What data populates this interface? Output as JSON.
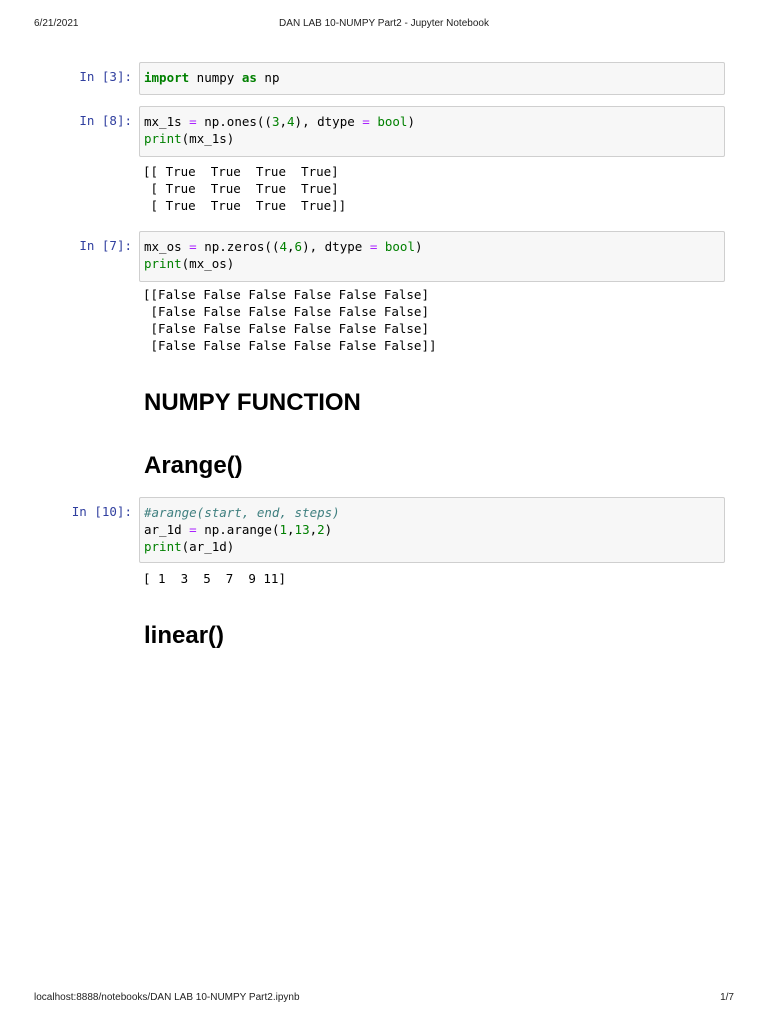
{
  "header": {
    "date": "6/21/2021",
    "title": "DAN LAB 10-NUMPY Part2 - Jupyter Notebook"
  },
  "footer": {
    "url": "localhost:8888/notebooks/DAN LAB 10-NUMPY Part2.ipynb",
    "page": "1/7"
  },
  "cells": [
    {
      "prompt": "In [3]:",
      "lines": [
        [
          {
            "t": "import",
            "c": "kw"
          },
          {
            "t": " numpy "
          },
          {
            "t": "as",
            "c": "kw"
          },
          {
            "t": " np"
          }
        ]
      ],
      "output": []
    },
    {
      "prompt": "In [8]:",
      "lines": [
        [
          {
            "t": "mx_1s "
          },
          {
            "t": "=",
            "c": "op"
          },
          {
            "t": " np.ones(("
          },
          {
            "t": "3",
            "c": "num"
          },
          {
            "t": ","
          },
          {
            "t": "4",
            "c": "num"
          },
          {
            "t": "), dtype "
          },
          {
            "t": "=",
            "c": "op"
          },
          {
            "t": " "
          },
          {
            "t": "bool",
            "c": "bi"
          },
          {
            "t": ")"
          }
        ],
        [
          {
            "t": "print",
            "c": "bi"
          },
          {
            "t": "(mx_1s)"
          }
        ]
      ],
      "output": [
        "[[ True  True  True  True]",
        " [ True  True  True  True]",
        " [ True  True  True  True]]"
      ]
    },
    {
      "prompt": "In [7]:",
      "lines": [
        [
          {
            "t": "mx_os "
          },
          {
            "t": "=",
            "c": "op"
          },
          {
            "t": " np.zeros(("
          },
          {
            "t": "4",
            "c": "num"
          },
          {
            "t": ","
          },
          {
            "t": "6",
            "c": "num"
          },
          {
            "t": "), dtype "
          },
          {
            "t": "=",
            "c": "op"
          },
          {
            "t": " "
          },
          {
            "t": "bool",
            "c": "bi"
          },
          {
            "t": ")"
          }
        ],
        [
          {
            "t": "print",
            "c": "bi"
          },
          {
            "t": "(mx_os)"
          }
        ]
      ],
      "output": [
        "[[False False False False False False]",
        " [False False False False False False]",
        " [False False False False False False]",
        " [False False False False False False]]"
      ]
    },
    {
      "prompt": "In [10]:",
      "lines": [
        [
          {
            "t": "#arange(start, end, steps)",
            "c": "cm"
          }
        ],
        [
          {
            "t": "ar_1d "
          },
          {
            "t": "=",
            "c": "op"
          },
          {
            "t": " np.arange("
          },
          {
            "t": "1",
            "c": "num"
          },
          {
            "t": ","
          },
          {
            "t": "13",
            "c": "num"
          },
          {
            "t": ","
          },
          {
            "t": "2",
            "c": "num"
          },
          {
            "t": ")"
          }
        ],
        [
          {
            "t": "print",
            "c": "bi"
          },
          {
            "t": "(ar_1d)"
          }
        ]
      ],
      "output": [
        "[ 1  3  5  7  9 11]"
      ]
    }
  ],
  "headings": [
    "NUMPY FUNCTION",
    "Arange()",
    "linear()"
  ]
}
